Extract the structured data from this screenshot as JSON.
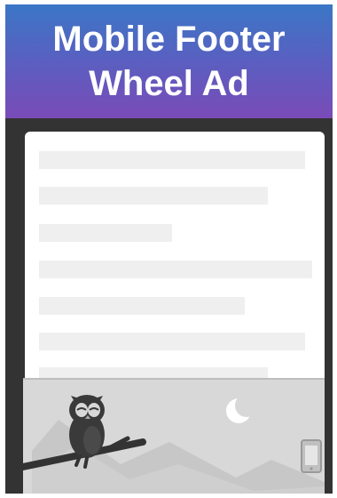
{
  "title": {
    "line1": "Mobile Footer",
    "line2": "Wheel Ad"
  },
  "icons": [
    "owl-icon",
    "moon-icon",
    "mountains-icon",
    "branch-icon",
    "phone-icon"
  ],
  "colors": {
    "header_top": "#3b77c6",
    "header_bottom": "#7a4bb8",
    "frame": "#333333",
    "placeholder": "#efefef",
    "ad_background": "#d8d8d8"
  }
}
